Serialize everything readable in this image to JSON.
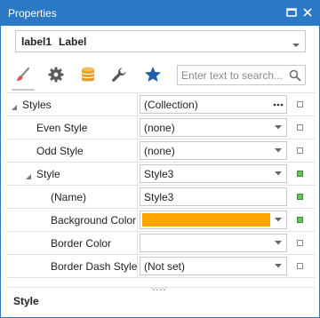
{
  "window": {
    "title": "Properties"
  },
  "object_selector": {
    "name": "label1",
    "type": "Label"
  },
  "toolbar": {
    "icons": [
      "brush-icon",
      "gear-icon",
      "database-icon",
      "wrench-icon",
      "star-icon"
    ],
    "active_tab": "brush-icon"
  },
  "search": {
    "placeholder": "Enter text to search..."
  },
  "properties": [
    {
      "label": "Styles",
      "value": "(Collection)",
      "editor": "ellipsis",
      "level": 0,
      "expander": "expanded",
      "marker": "unset"
    },
    {
      "label": "Even Style",
      "value": "(none)",
      "editor": "dropdown",
      "level": 1,
      "expander": "none",
      "marker": "unset"
    },
    {
      "label": "Odd Style",
      "value": "(none)",
      "editor": "dropdown",
      "level": 1,
      "expander": "none",
      "marker": "unset"
    },
    {
      "label": "Style",
      "value": "Style3",
      "editor": "dropdown",
      "level": 1,
      "expander": "expanded",
      "marker": "set"
    },
    {
      "label": "(Name)",
      "value": "Style3",
      "editor": "text",
      "level": 2,
      "expander": "none",
      "marker": "set"
    },
    {
      "label": "Background Color",
      "value": "",
      "editor": "color",
      "color": "#FFA500",
      "level": 2,
      "expander": "none",
      "marker": "set"
    },
    {
      "label": "Border Color",
      "value": "",
      "editor": "color",
      "color": "",
      "level": 2,
      "expander": "none",
      "marker": "unset"
    },
    {
      "label": "Border Dash Style",
      "value": "(Not set)",
      "editor": "dropdown",
      "level": 2,
      "expander": "none",
      "marker": "unset"
    }
  ],
  "description": {
    "title": "Style"
  },
  "colors": {
    "accent": "#2B78C5",
    "brush": "#D9534F",
    "star": "#1F5FAD",
    "database": "#E0A030",
    "marker_set": "#6BBF59"
  }
}
